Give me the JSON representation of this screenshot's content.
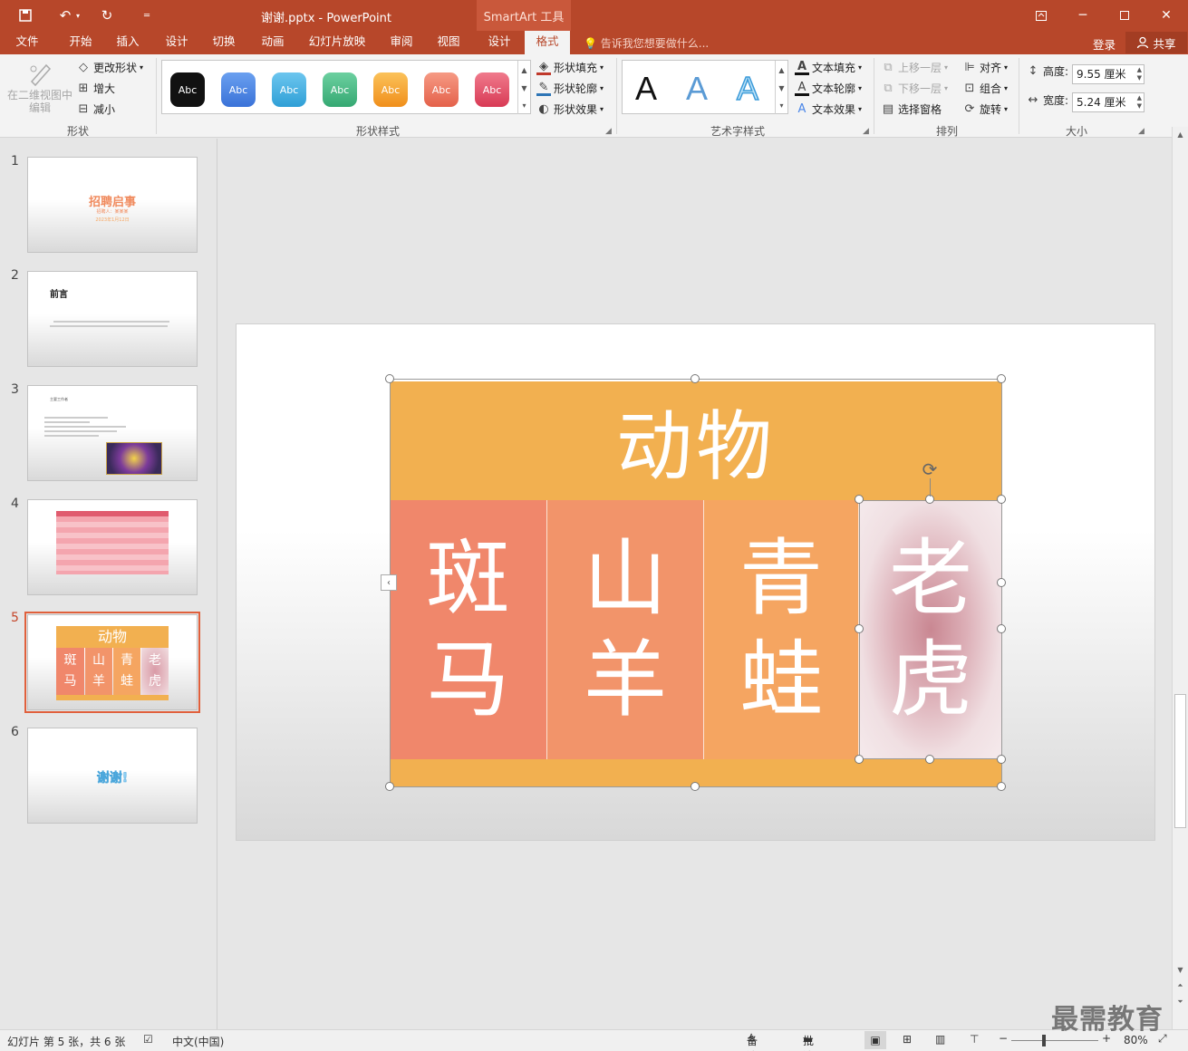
{
  "titlebar": {
    "doc_title": "谢谢.pptx - PowerPoint",
    "contextual_tab": "SmartArt 工具",
    "quick_access": [
      "save-icon",
      "undo-icon",
      "redo-icon",
      "customize-icon"
    ]
  },
  "tabs": [
    {
      "label": "文件"
    },
    {
      "label": "开始"
    },
    {
      "label": "插入"
    },
    {
      "label": "设计"
    },
    {
      "label": "切换"
    },
    {
      "label": "动画"
    },
    {
      "label": "幻灯片放映"
    },
    {
      "label": "审阅"
    },
    {
      "label": "视图"
    },
    {
      "label": "设计"
    },
    {
      "label": "格式"
    }
  ],
  "tell_me": "告诉我您想要做什么...",
  "account": {
    "login": "登录",
    "share": "共享"
  },
  "ribbon": {
    "shapes_group": {
      "edit_2d": "在二维视图中编辑",
      "change_shape": "更改形状",
      "larger": "增大",
      "smaller": "减小",
      "label": "形状"
    },
    "shape_styles": {
      "swatch_text": "Abc",
      "swatch_colors": [
        "#111111",
        "#4a86e8",
        "#45b3e6",
        "#4cbe8a",
        "#f6a52f",
        "#ef7b63",
        "#e8516a"
      ],
      "fill": "形状填充",
      "outline": "形状轮廓",
      "effects": "形状效果",
      "label": "形状样式"
    },
    "wordart": {
      "letter": "A",
      "fill": "文本填充",
      "outline": "文本轮廓",
      "effects": "文本效果",
      "label": "艺术字样式"
    },
    "arrange": {
      "bring_forward": "上移一层",
      "send_backward": "下移一层",
      "selection_pane": "选择窗格",
      "align": "对齐",
      "group": "组合",
      "rotate": "旋转",
      "label": "排列"
    },
    "size": {
      "height_label": "高度:",
      "height_value": "9.55 厘米",
      "width_label": "宽度:",
      "width_value": "5.24 厘米",
      "label": "大小"
    }
  },
  "slides": [
    {
      "num": "1",
      "title": "招聘启事",
      "sub1": "招聘人：某某某",
      "sub2": "2023年1月12日"
    },
    {
      "num": "2",
      "title": "前言"
    },
    {
      "num": "3",
      "title": "主要工作者"
    },
    {
      "num": "4"
    },
    {
      "num": "5",
      "title": "动物",
      "cells": [
        "斑马",
        "山羊",
        "青蛙",
        "老虎"
      ]
    },
    {
      "num": "6",
      "title": "谢谢!"
    }
  ],
  "smartart": {
    "header": "动物",
    "cells": [
      {
        "top": "斑",
        "bottom": "马",
        "color": "#f0876b"
      },
      {
        "top": "山",
        "bottom": "羊",
        "color": "#f2946a"
      },
      {
        "top": "青",
        "bottom": "蛙",
        "color": "#f5a561"
      }
    ],
    "selected_cell": {
      "top": "老",
      "bottom": "虎"
    },
    "header_color": "#f2b050"
  },
  "status": {
    "slide_info": "幻灯片 第 5 张，共 6 张",
    "language": "中文(中国)",
    "notes": "备注",
    "comments": "批注",
    "zoom": "80%"
  },
  "watermark": "最需教育"
}
